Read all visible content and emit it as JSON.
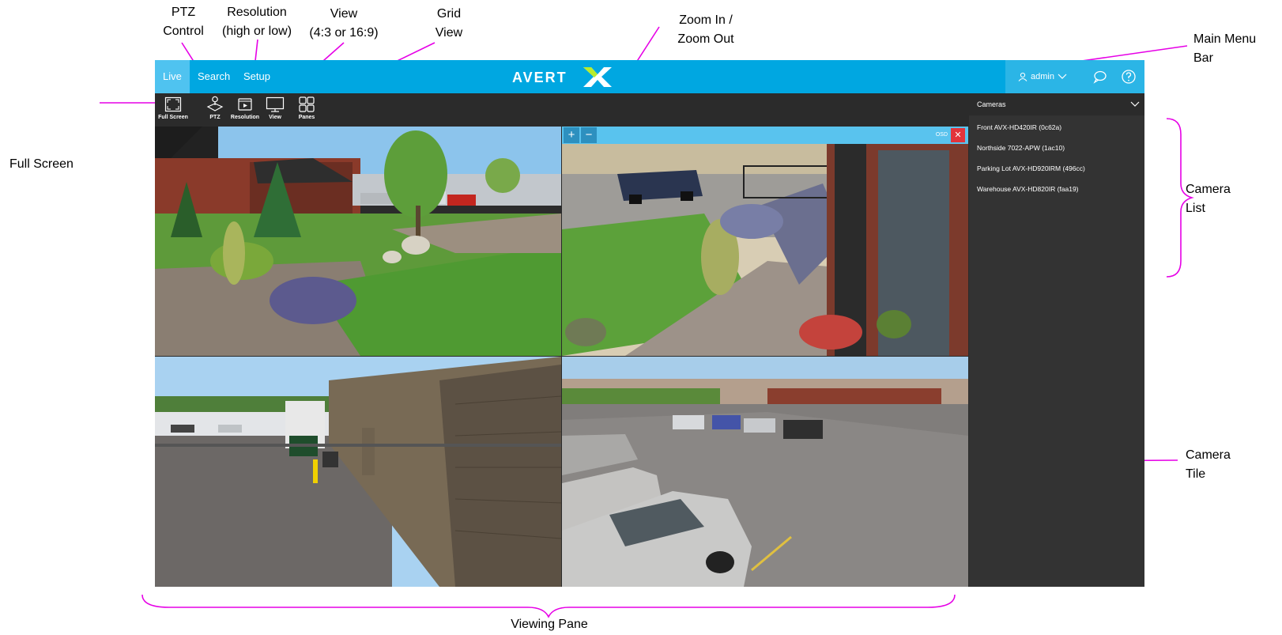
{
  "callouts": {
    "ptz_line1": "PTZ",
    "ptz_line2": "Control",
    "resolution_line1": "Resolution",
    "resolution_line2": "(high or low)",
    "view_line1": "View",
    "view_line2": "(4:3 or 16:9)",
    "grid_line1": "Grid",
    "grid_line2": "View",
    "zoom_line1": "Zoom In /",
    "zoom_line2": "Zoom Out",
    "menu_line1": "Main Menu",
    "menu_line2": "Bar",
    "full_screen": "Full Screen",
    "camera_list_line1": "Camera",
    "camera_list_line2": "List",
    "camera_tile_line1": "Camera",
    "camera_tile_line2": "Tile",
    "viewing_pane": "Viewing Pane",
    "line_color": "#e600e6"
  },
  "menubar": {
    "tabs": [
      "Live",
      "Search",
      "Setup"
    ],
    "active_tab": "Live",
    "user": "admin",
    "logo_text": "AVERTX",
    "brand_color": "#00a7e1"
  },
  "toolbar": {
    "items": [
      {
        "label": "Full Screen",
        "icon": "fullscreen-icon"
      },
      {
        "label": "PTZ",
        "icon": "ptz-joystick-icon"
      },
      {
        "label": "Resolution",
        "icon": "resolution-icon"
      },
      {
        "label": "View",
        "icon": "monitor-icon"
      },
      {
        "label": "Panes",
        "icon": "grid-icon"
      }
    ]
  },
  "tile_controls": {
    "zoom_in": "+",
    "zoom_out": "−",
    "osd": "OSD",
    "close": "✕"
  },
  "sidebar": {
    "title": "Cameras",
    "cameras": [
      "Front AVX-HD420IR (0c62a)",
      "Northside 7022-APW (1ac10)",
      "Parking Lot AVX-HD920IRM (496cc)",
      "Warehouse AVX-HD820IR (faa19)"
    ]
  }
}
